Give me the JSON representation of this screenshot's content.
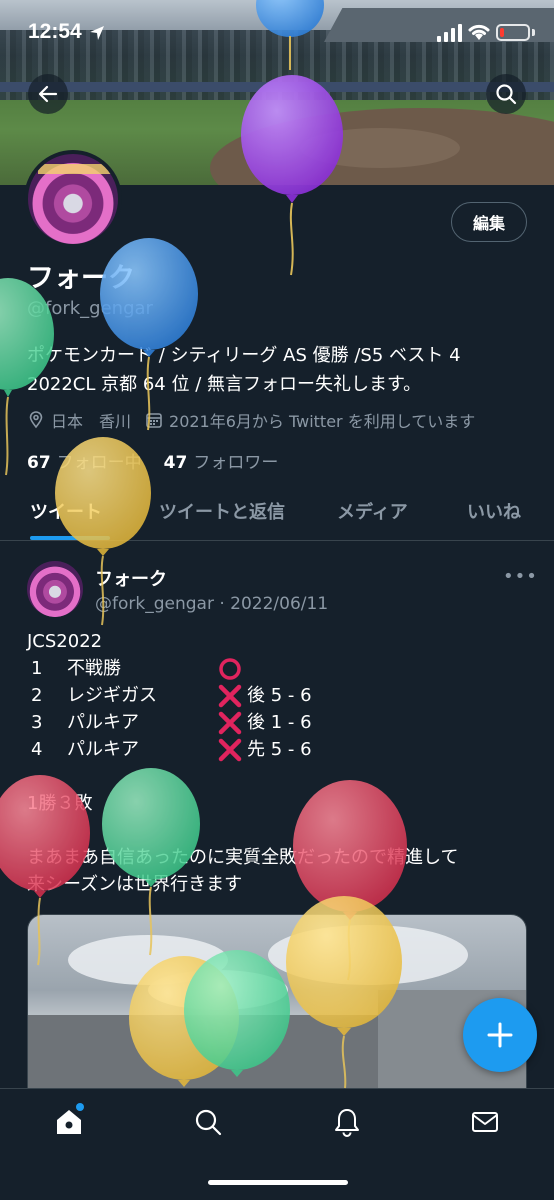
{
  "status_bar": {
    "time": "12:54"
  },
  "profile": {
    "edit_label": "編集",
    "display_name": "フォーク",
    "handle": "@fork_gengar",
    "bio_line1": "ポケモンカード / シティリーグ AS 優勝 /S5 ベスト 4",
    "bio_line2": "2022CL 京都 64 位 / 無言フォロー失礼します。",
    "location": "日本　香川",
    "joined": "2021年6月から Twitter を利用しています",
    "following_count": "67",
    "following_label": "フォロー中",
    "followers_count": "47",
    "followers_label": "フォロワー"
  },
  "tabs": [
    {
      "label": "ツイート"
    },
    {
      "label": "ツイートと返信"
    },
    {
      "label": "メディア"
    },
    {
      "label": "いいね"
    }
  ],
  "tweet": {
    "name": "フォーク",
    "meta": "@fork_gengar · 2022/06/11",
    "title": "JCS2022",
    "results": [
      {
        "round": "1",
        "opponent": "不戦勝",
        "mark": "circle",
        "score": ""
      },
      {
        "round": "2",
        "opponent": "レジギガス",
        "mark": "cross",
        "score": "後 5 - 6"
      },
      {
        "round": "3",
        "opponent": "パルキア",
        "mark": "cross",
        "score": "後 1 - 6"
      },
      {
        "round": "4",
        "opponent": "パルキア",
        "mark": "cross",
        "score": "先 5 - 6"
      }
    ],
    "record": "1勝３敗",
    "line_a": "まあまあ自信あったのに実質全敗だったので精進して",
    "line_b": "来シーズンは世界行きます"
  },
  "colors": {
    "background": "#15202b",
    "accent": "#1d9bf0",
    "muted_text": "#8b98a5",
    "divider": "#38444d",
    "cross_red": "#e0245e",
    "circle_red": "#e0245e"
  },
  "icons": [
    "back-arrow-icon",
    "search-icon",
    "location-pin-icon",
    "calendar-icon",
    "more-icon",
    "home-icon",
    "explore-search-icon",
    "bell-icon",
    "mail-icon",
    "compose-plus-icon"
  ]
}
